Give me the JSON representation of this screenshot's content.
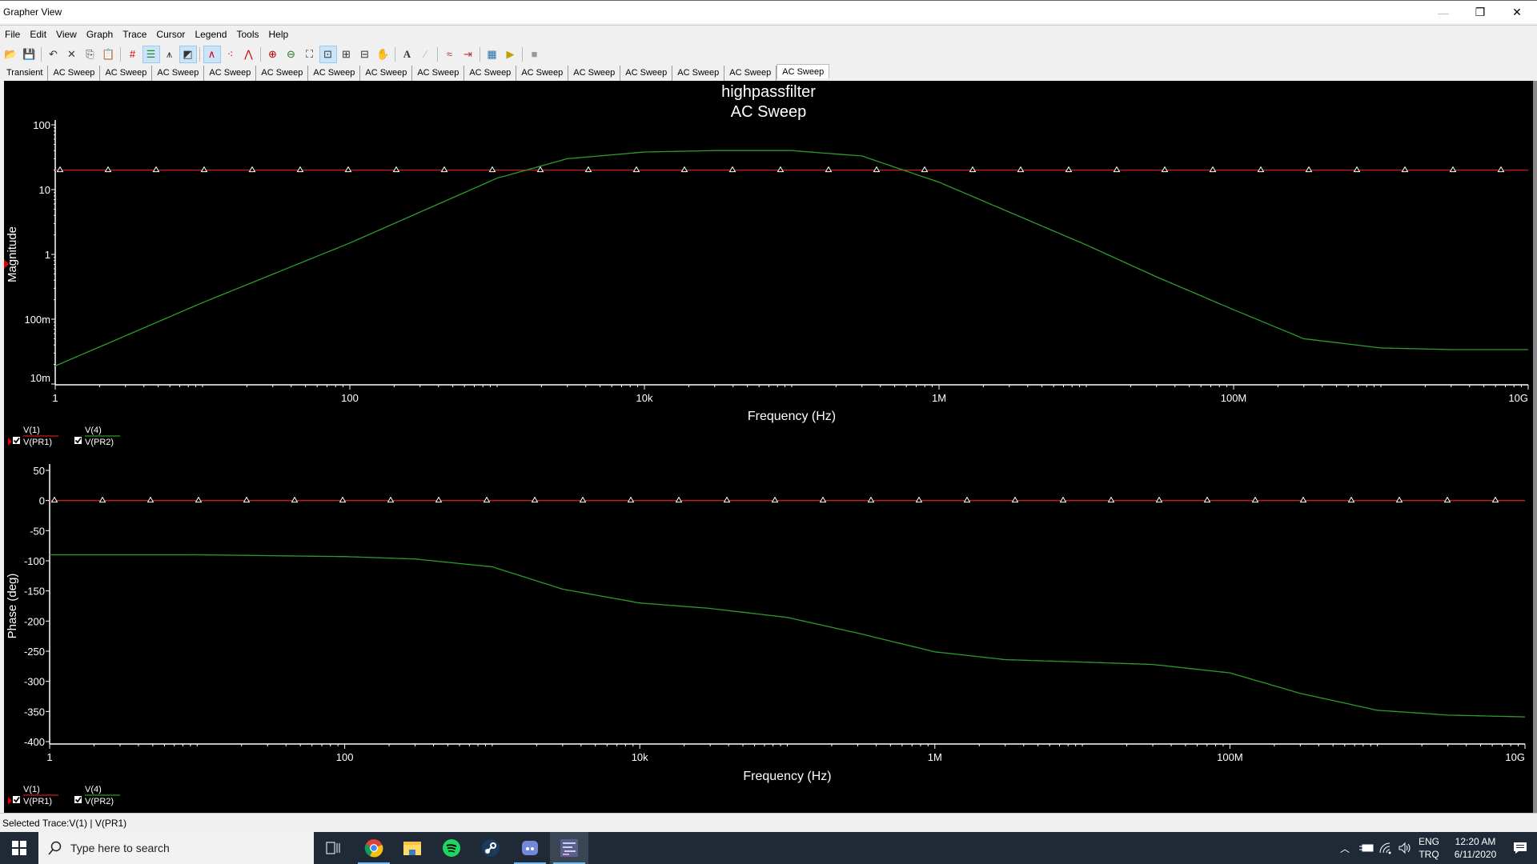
{
  "window": {
    "title": "Grapher View",
    "minimize_label": "—",
    "restore_label": "❐",
    "close_label": "✕"
  },
  "menu": [
    "File",
    "Edit",
    "View",
    "Graph",
    "Trace",
    "Cursor",
    "Legend",
    "Tools",
    "Help"
  ],
  "toolbar": [
    {
      "icon": "open-icon",
      "glyph": "📂",
      "active": false
    },
    {
      "icon": "save-icon",
      "glyph": "💾",
      "active": false
    },
    {
      "sep": true
    },
    {
      "icon": "undo-icon",
      "glyph": "↶",
      "active": false
    },
    {
      "icon": "cut-icon",
      "glyph": "✕",
      "active": false
    },
    {
      "icon": "copy-icon",
      "glyph": "⎘",
      "active": false
    },
    {
      "icon": "paste-icon",
      "glyph": "📋",
      "active": false
    },
    {
      "sep": true
    },
    {
      "icon": "grid-icon",
      "glyph": "#",
      "active": false,
      "color": "#d00000"
    },
    {
      "icon": "legend-icon",
      "glyph": "☰",
      "active": true,
      "color": "#2a8a2a"
    },
    {
      "icon": "cursors-icon",
      "glyph": "⩚",
      "active": false
    },
    {
      "icon": "reverse-colors-icon",
      "glyph": "◩",
      "active": true
    },
    {
      "sep": true
    },
    {
      "icon": "lines-icon",
      "glyph": "∧",
      "active": true,
      "color": "#d00000"
    },
    {
      "icon": "markers-icon",
      "glyph": "⁖",
      "active": false,
      "color": "#d00000"
    },
    {
      "icon": "lines-markers-icon",
      "glyph": "⋀",
      "active": false,
      "color": "#d00000"
    },
    {
      "sep": true
    },
    {
      "icon": "zoom-in-icon",
      "glyph": "⊕",
      "active": false,
      "color": "#b00000"
    },
    {
      "icon": "zoom-out-icon",
      "glyph": "⊖",
      "active": false,
      "color": "#207020"
    },
    {
      "icon": "zoom-fit-icon",
      "glyph": "⛶",
      "active": false
    },
    {
      "icon": "zoom-area-icon",
      "glyph": "⊡",
      "active": true
    },
    {
      "icon": "zoom-x-icon",
      "glyph": "⊞",
      "active": false
    },
    {
      "icon": "zoom-y-icon",
      "glyph": "⊟",
      "active": false
    },
    {
      "icon": "pan-hand-icon",
      "glyph": "✋",
      "active": false
    },
    {
      "sep": true
    },
    {
      "icon": "text-icon",
      "glyph": "A",
      "active": false
    },
    {
      "icon": "label-point-icon",
      "glyph": "⁄",
      "active": false,
      "color": "#bbb"
    },
    {
      "sep": true
    },
    {
      "icon": "trace-overlay-icon",
      "glyph": "≈",
      "active": false,
      "color": "#c03030"
    },
    {
      "icon": "export-data-icon",
      "glyph": "⇥",
      "active": false,
      "color": "#c03030"
    },
    {
      "sep": true
    },
    {
      "icon": "export-excel-icon",
      "glyph": "▦",
      "active": false,
      "color": "#2070b0"
    },
    {
      "icon": "export-lvm-icon",
      "glyph": "▶",
      "active": false,
      "color": "#c0a000"
    },
    {
      "sep": true
    },
    {
      "icon": "stop-icon",
      "glyph": "■",
      "active": false,
      "color": "#999"
    }
  ],
  "tabs": [
    {
      "label": "Transient",
      "active": false
    },
    {
      "label": "AC Sweep",
      "active": false
    },
    {
      "label": "AC Sweep",
      "active": false
    },
    {
      "label": "AC Sweep",
      "active": false
    },
    {
      "label": "AC Sweep",
      "active": false
    },
    {
      "label": "AC Sweep",
      "active": false
    },
    {
      "label": "AC Sweep",
      "active": false
    },
    {
      "label": "AC Sweep",
      "active": false
    },
    {
      "label": "AC Sweep",
      "active": false
    },
    {
      "label": "AC Sweep",
      "active": false
    },
    {
      "label": "AC Sweep",
      "active": false
    },
    {
      "label": "AC Sweep",
      "active": false
    },
    {
      "label": "AC Sweep",
      "active": false
    },
    {
      "label": "AC Sweep",
      "active": false
    },
    {
      "label": "AC Sweep",
      "active": false
    },
    {
      "label": "AC Sweep",
      "active": true
    }
  ],
  "graph": {
    "title_line1": "highpassfilter",
    "title_line2": "AC Sweep"
  },
  "colors": {
    "trace1": "#c81e1e",
    "trace2": "#2e9a2e",
    "background": "#000000",
    "axis": "#ffffff"
  },
  "chart_data": [
    {
      "type": "line",
      "title": "highpassfilter AC Sweep",
      "xlabel": "Frequency (Hz)",
      "ylabel": "Magnitude",
      "xscale": "log",
      "yscale": "log",
      "xlim": [
        1,
        10000000000
      ],
      "ylim": [
        0.01,
        100
      ],
      "xticks": [
        1,
        100,
        10000,
        1000000,
        100000000,
        10000000000
      ],
      "xtick_labels": [
        "1",
        "100",
        "10k",
        "1M",
        "100M",
        "10G"
      ],
      "yticks": [
        0.01,
        0.1,
        1,
        10,
        100
      ],
      "ytick_labels": [
        "10m",
        "100m",
        "1",
        "10",
        "100"
      ],
      "grid": false,
      "legend": "bottom-left",
      "series": [
        {
          "name": "V(1) | V(PR1)",
          "top": "V(1)",
          "bottom": "V(PR1)",
          "color": "#c81e1e",
          "markers": "triangle",
          "checked": true,
          "selected": true,
          "x": [
            1,
            10000000000
          ],
          "y": [
            20,
            20
          ]
        },
        {
          "name": "V(4) | V(PR2)",
          "top": "V(4)",
          "bottom": "V(PR2)",
          "color": "#2e9a2e",
          "markers": "none",
          "checked": true,
          "selected": false,
          "x": [
            1,
            10,
            100,
            1000,
            3000,
            10000,
            30000,
            100000,
            300000,
            1000000,
            3000000,
            10000000,
            30000000,
            100000000,
            300000000,
            1000000000,
            3000000000,
            10000000000
          ],
          "y": [
            0.019,
            0.18,
            1.5,
            15,
            30,
            38,
            40,
            40,
            33,
            13,
            4.5,
            1.4,
            0.45,
            0.14,
            0.05,
            0.036,
            0.034,
            0.034
          ]
        }
      ]
    },
    {
      "type": "line",
      "title": "",
      "xlabel": "Frequency (Hz)",
      "ylabel": "Phase (deg)",
      "xscale": "log",
      "yscale": "linear",
      "xlim": [
        1,
        10000000000
      ],
      "ylim": [
        -400,
        50
      ],
      "xticks": [
        1,
        100,
        10000,
        1000000,
        100000000,
        10000000000
      ],
      "xtick_labels": [
        "1",
        "100",
        "10k",
        "1M",
        "100M",
        "10G"
      ],
      "yticks": [
        50,
        0,
        -50,
        -100,
        -150,
        -200,
        -250,
        -300,
        -350,
        -400
      ],
      "ytick_labels": [
        "50",
        "0",
        "-50",
        "-100",
        "-150",
        "-200",
        "-250",
        "-300",
        "-350",
        "-400"
      ],
      "grid": false,
      "legend": "bottom-left",
      "series": [
        {
          "name": "V(1) | V(PR1)",
          "top": "V(1)",
          "bottom": "V(PR1)",
          "color": "#c81e1e",
          "markers": "triangle",
          "checked": true,
          "selected": true,
          "x": [
            1,
            10000000000
          ],
          "y": [
            0,
            0
          ]
        },
        {
          "name": "V(4) | V(PR2)",
          "top": "V(4)",
          "bottom": "V(PR2)",
          "color": "#2e9a2e",
          "markers": "none",
          "checked": true,
          "selected": false,
          "x": [
            1,
            10,
            100,
            300,
            1000,
            3000,
            10000,
            30000,
            100000,
            300000,
            1000000,
            3000000,
            10000000,
            30000000,
            100000000,
            300000000,
            1000000000,
            3000000000,
            10000000000
          ],
          "y": [
            -90,
            -90,
            -93,
            -97,
            -110,
            -147,
            -170,
            -179,
            -194,
            -220,
            -251,
            -264,
            -268,
            -272,
            -286,
            -320,
            -348,
            -356,
            -359
          ]
        }
      ]
    }
  ],
  "status": {
    "text": "Selected Trace:V(1) | V(PR1)"
  },
  "taskbar": {
    "search_placeholder": "Type here to search",
    "apps": [
      "task-view-icon",
      "chrome-icon",
      "file-explorer-icon",
      "spotify-icon",
      "steam-icon",
      "discord-icon",
      "multisim-icon"
    ],
    "lang_top": "ENG",
    "lang_bottom": "TRQ",
    "time": "12:20 AM",
    "date": "6/11/2020"
  }
}
